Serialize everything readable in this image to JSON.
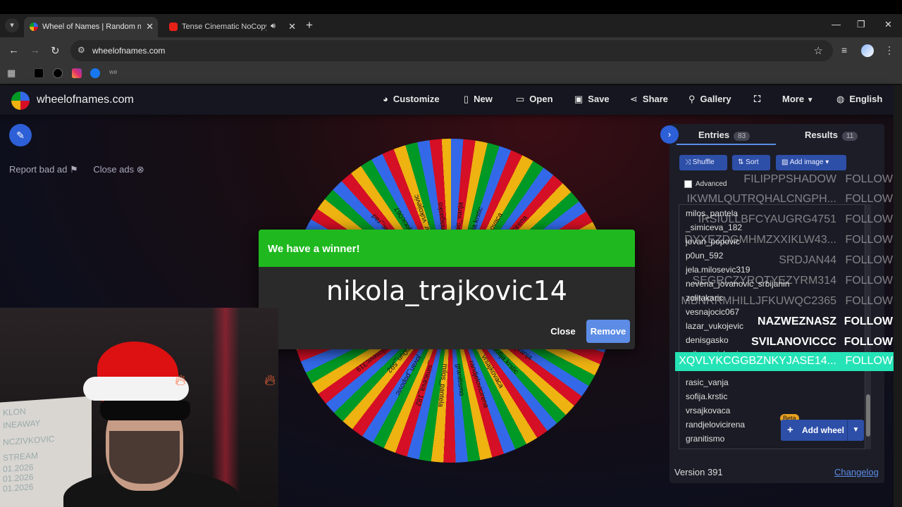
{
  "browser": {
    "tabs": [
      {
        "title": "Wheel of Names | Random name",
        "active": true
      },
      {
        "title": "Tense Cinematic NoCopyrig",
        "active": false
      }
    ],
    "url": "wheelofnames.com"
  },
  "site": {
    "brand": "wheelofnames.com",
    "menu": {
      "customize": "Customize",
      "new": "New",
      "open": "Open",
      "save": "Save",
      "share": "Share",
      "gallery": "Gallery",
      "more": "More",
      "language": "English"
    },
    "ads": {
      "report": "Report bad ad",
      "close": "Close ads"
    }
  },
  "wheel": {
    "labels": [
      "vesnajocic067",
      "lazar_vukojevic",
      "denisgasko",
      "rasic_vanja",
      "sofija.krstic",
      "vrsajkovaca",
      "randjelovicirena",
      "granitismo",
      "milos_pantela",
      "_simiceva_182",
      "jovan_popovic",
      "p0un_592",
      "jela.milosevic319",
      "zolitakaric",
      "ivonkastojanovic",
      "trajkovic18",
      "simovicvelika",
      "zivanovic97",
      "pavlovic5389",
      "sladjana_ilic_rad"
    ]
  },
  "dialog": {
    "title": "We have a winner!",
    "winner": "nikola_trajkovic14",
    "close_label": "Close",
    "remove_label": "Remove"
  },
  "panel": {
    "entries_tab": "Entries",
    "entries_count": "83",
    "results_tab": "Results",
    "results_count": "11",
    "shuffle": "Shuffle",
    "sort": "Sort",
    "add_image": "Add image",
    "advanced": "Advanced",
    "entries": [
      "milos_pantela",
      "_simiceva_182",
      "jovan_popovic",
      "p0un_592",
      "jela.milosevic319",
      "nevena_jovanovic_srbijanin",
      "zolitakaric",
      "vesnajocic067",
      "lazar_vukojevic",
      "denisgasko",
      "milos_miskovic",
      "rasic_vanja",
      "sofija.krstic",
      "vrsajkovaca",
      "randjelovicirena",
      "granitismo"
    ],
    "beta": "Beta",
    "add_wheel": "Add wheel",
    "version": "Version 391",
    "changelog": "Changelog"
  },
  "stream_overlay": {
    "follows": [
      {
        "name": "FILIPPPSHADOW",
        "action": "FOLLOW",
        "style": "dim"
      },
      {
        "name": "IKWMLQUTRQHALCNGPH...",
        "action": "FOLLOW",
        "style": "dim"
      },
      {
        "name": "IRSIULLBFCYAUGRG4751",
        "action": "FOLLOW",
        "style": "dim"
      },
      {
        "name": "DYXEZDGMHMZXXIKLW43...",
        "action": "FOLLOW",
        "style": "dim"
      },
      {
        "name": "SRDJAN44",
        "action": "FOLLOW",
        "style": "dim"
      },
      {
        "name": "SEGRCZYROTYEZYRM314",
        "action": "FOLLOW",
        "style": "dim"
      },
      {
        "name": "MBNRRMHILLJFKUWQC2365",
        "action": "FOLLOW",
        "style": "dim"
      },
      {
        "name": "NAZWEZNASZ",
        "action": "FOLLOW",
        "style": "bright"
      },
      {
        "name": "SVILANOVICCC",
        "action": "FOLLOW",
        "style": "bright"
      },
      {
        "name": "XQVLYKCGGBZNKYJASE14...",
        "action": "FOLLOW",
        "style": "hl"
      }
    ]
  },
  "webcam": {
    "board_lines": [
      "KLON",
      "INEAWAY",
      "NCZIVKOVIC",
      "STREAM",
      "01.2026",
      "01.2026",
      "01.2026"
    ]
  },
  "colors": {
    "accent": "#5c8ce6",
    "winner_header": "#1fb91f",
    "overlay_highlight": "#25e3b6"
  }
}
